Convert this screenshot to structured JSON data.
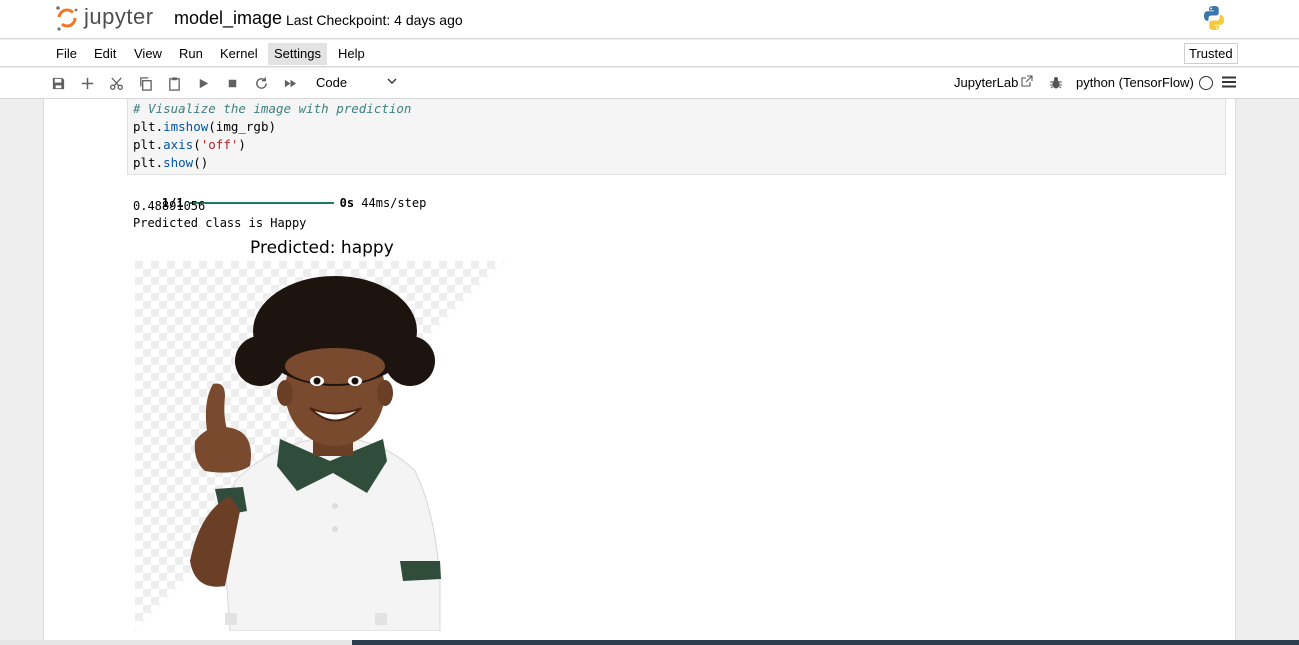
{
  "header": {
    "logo_text": "jupyter",
    "notebook_title": "model_image",
    "checkpoint": "Last Checkpoint: 4 days ago"
  },
  "menubar": {
    "items": [
      "File",
      "Edit",
      "View",
      "Run",
      "Kernel",
      "Settings",
      "Help"
    ],
    "active_item": "Settings",
    "trusted_label": "Trusted"
  },
  "toolbar": {
    "icons": [
      "save-icon",
      "add-icon",
      "cut-icon",
      "copy-icon",
      "paste-icon",
      "run-icon",
      "stop-icon",
      "restart-icon",
      "fast-forward-icon"
    ],
    "cell_type": "Code",
    "jupyterlab_label": "JupyterLab",
    "kernel_name": "python (TensorFlow)"
  },
  "code_cell": {
    "lines": [
      "# Visualize the image with prediction",
      "plt.imshow(img_rgb)",
      "plt.axis('off')",
      "plt.show()"
    ]
  },
  "output": {
    "progress_prefix": "1/1",
    "progress_suffix": "0s",
    "progress_rate": "44ms/step",
    "progress_fraction": 1.0,
    "value_line": "0.48891056",
    "prediction_line": "Predicted class is Happy",
    "plot_title": "Predicted: happy"
  },
  "colors": {
    "progress": "#1a7f5a",
    "shirt_collar": "#2f4d3a",
    "jupyter_orange": "#f37726"
  }
}
